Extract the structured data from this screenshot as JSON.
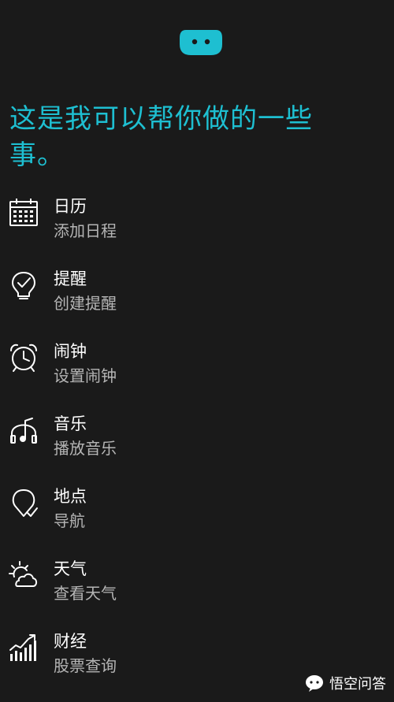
{
  "headline": "这是我可以帮你做的一些事。",
  "accent_color": "#1ebfd1",
  "items": [
    {
      "title": "日历",
      "subtitle": "添加日程",
      "icon": "calendar-icon"
    },
    {
      "title": "提醒",
      "subtitle": "创建提醒",
      "icon": "reminder-icon"
    },
    {
      "title": "闹钟",
      "subtitle": "设置闹钟",
      "icon": "alarm-clock-icon"
    },
    {
      "title": "音乐",
      "subtitle": "播放音乐",
      "icon": "music-icon"
    },
    {
      "title": "地点",
      "subtitle": "导航",
      "icon": "location-icon"
    },
    {
      "title": "天气",
      "subtitle": "查看天气",
      "icon": "weather-icon"
    },
    {
      "title": "财经",
      "subtitle": "股票查询",
      "icon": "finance-chart-icon"
    }
  ],
  "watermark": {
    "text": "悟空问答",
    "icon": "chat-bubble-icon"
  }
}
